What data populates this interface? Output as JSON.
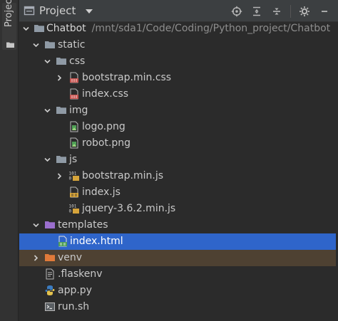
{
  "side_strip": {
    "tab_label": "Project",
    "tab_icon": "folder-icon"
  },
  "header": {
    "view_label": "Project",
    "view_icon": "project-view-icon",
    "dropdown_icon": "chevron-down-icon",
    "tools": [
      "locate-icon",
      "expand-all-icon",
      "collapse-all-icon",
      "gear-icon",
      "minimize-icon"
    ]
  },
  "tree": {
    "root": {
      "name": "Chatbot",
      "path": "/mnt/sda1/Code/Coding/Python_project/Chatbot"
    },
    "items": [
      {
        "label": "static",
        "type": "folder",
        "expanded": true
      },
      {
        "label": "css",
        "type": "folder",
        "expanded": true
      },
      {
        "label": "bootstrap.min.css",
        "type": "css",
        "expanded": false
      },
      {
        "label": "index.css",
        "type": "css"
      },
      {
        "label": "img",
        "type": "folder",
        "expanded": true
      },
      {
        "label": "logo.png",
        "type": "image"
      },
      {
        "label": "robot.png",
        "type": "image"
      },
      {
        "label": "js",
        "type": "folder",
        "expanded": true
      },
      {
        "label": "bootstrap.min.js",
        "type": "js-binary",
        "expanded": false
      },
      {
        "label": "index.js",
        "type": "js"
      },
      {
        "label": "jquery-3.6.2.min.js",
        "type": "js-binary"
      },
      {
        "label": "templates",
        "type": "templates-folder",
        "expanded": true
      },
      {
        "label": "index.html",
        "type": "html",
        "selected": true
      },
      {
        "label": "venv",
        "type": "excluded-folder",
        "expanded": false
      },
      {
        "label": ".flaskenv",
        "type": "text"
      },
      {
        "label": "app.py",
        "type": "python"
      },
      {
        "label": "run.sh",
        "type": "shell"
      }
    ]
  },
  "colors": {
    "background": "#2b2b2b",
    "header": "#3c3f41",
    "selection": "#2f65ca",
    "excluded": "#4e4132",
    "folder": "#8f9aa5",
    "css": "#c75450",
    "js": "#d6a43b",
    "html": "#4f9f56",
    "python": "#3b7bbf"
  }
}
